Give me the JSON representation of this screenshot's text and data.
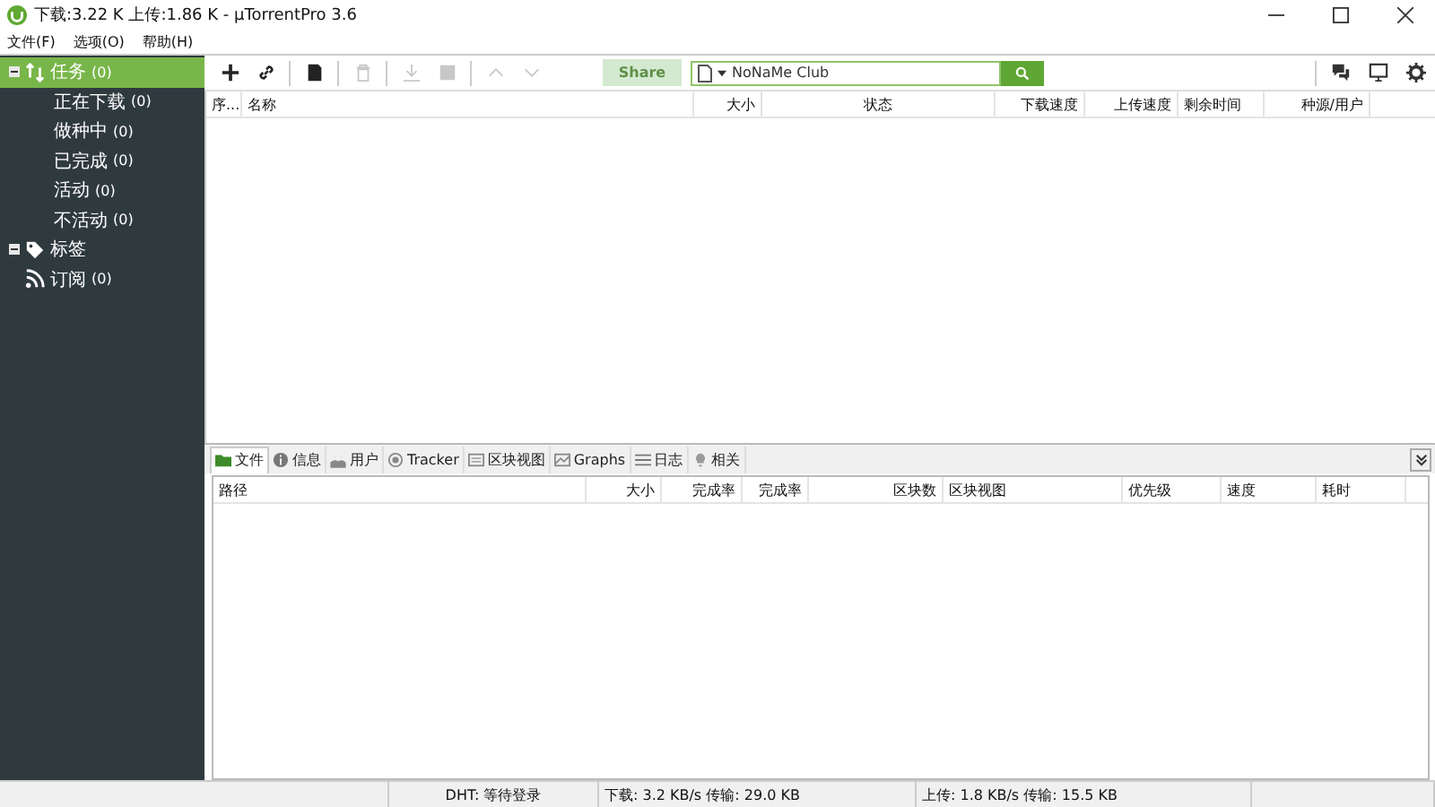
{
  "window": {
    "title": "下载:3.22 K 上传:1.86 K - µTorrentPro 3.6"
  },
  "menu": [
    "文件(F)",
    "选项(O)",
    "帮助(H)"
  ],
  "sidebar": {
    "items": [
      {
        "kind": "tasks",
        "label": "任务",
        "count": "(0)",
        "selected": true,
        "expanded": true,
        "children": [
          {
            "label": "正在下载",
            "count": "(0)",
            "selected": false
          },
          {
            "label": "做种中",
            "count": "(0)",
            "selected": false
          },
          {
            "label": "已完成",
            "count": "(0)",
            "selected": false
          },
          {
            "label": "活动",
            "count": "(0)",
            "selected": false
          },
          {
            "label": "不活动",
            "count": "(0)",
            "selected": false
          }
        ]
      },
      {
        "kind": "labels",
        "label": "标签",
        "selected": false,
        "expanded": true
      },
      {
        "kind": "feed",
        "label": "订阅",
        "count": "(0)",
        "selected": false
      }
    ]
  },
  "toolbar": {
    "buttons": [
      {
        "kind": "add",
        "disabled": false
      },
      {
        "kind": "link",
        "disabled": false
      },
      {
        "kind": "create",
        "disabled": false
      },
      {
        "kind": "delete",
        "disabled": true
      },
      {
        "kind": "download",
        "disabled": true
      },
      {
        "kind": "stop",
        "disabled": true
      },
      {
        "kind": "up",
        "disabled": true
      },
      {
        "kind": "down",
        "disabled": true
      }
    ],
    "share": {
      "label": "Share",
      "disabled": true
    },
    "search": {
      "value": "NoNaMe Club"
    }
  },
  "torrents": {
    "columns": [
      "序...",
      "名称",
      "大小",
      "状态",
      "下载速度",
      "上传速度",
      "剩余时间",
      "种源/用户"
    ]
  },
  "detail_tabs": [
    {
      "kind": "files",
      "label": "文件",
      "selected": true
    },
    {
      "kind": "info",
      "label": "信息",
      "selected": false
    },
    {
      "kind": "peers",
      "label": "用户",
      "selected": false
    },
    {
      "kind": "tracker",
      "label": "Tracker",
      "selected": false
    },
    {
      "kind": "pieces",
      "label": "区块视图",
      "selected": false
    },
    {
      "kind": "graphs",
      "label": "Graphs",
      "selected": false
    },
    {
      "kind": "log",
      "label": "日志",
      "selected": false
    },
    {
      "kind": "related",
      "label": "相关",
      "selected": false
    }
  ],
  "files": {
    "columns": [
      "路径",
      "大小",
      "完成率",
      "完成率",
      "区块数",
      "区块视图",
      "优先级",
      "速度",
      "耗时"
    ]
  },
  "status_bar": [
    "DHT: 等待登录",
    "下载: 3.2 KB/s 传输: 29.0 KB",
    "上传: 1.8 KB/s 传输: 15.5 KB"
  ]
}
